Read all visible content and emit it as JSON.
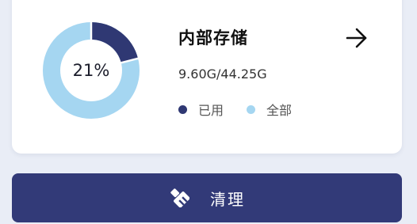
{
  "storage": {
    "title": "内部存储",
    "percent_label": "21%",
    "used_fraction": 0.21,
    "size_text": "9.60G/44.25G",
    "legend": [
      {
        "label": "已用",
        "color": "#2f3873"
      },
      {
        "label": "全部",
        "color": "#a5d6f1"
      }
    ],
    "arrow_icon": "arrow-right-icon"
  },
  "actions": {
    "clean_label": "清理",
    "clean_icon": "broom-icon"
  },
  "colors": {
    "used": "#2f3873",
    "total": "#a5d6f1",
    "button": "#323a78"
  }
}
